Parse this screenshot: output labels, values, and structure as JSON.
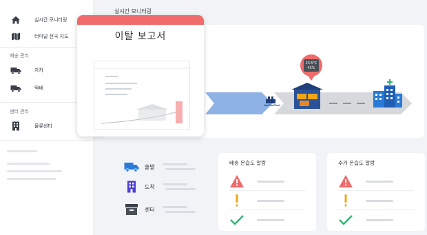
{
  "sidebar": {
    "items": [
      {
        "label": "실시간 모니터링",
        "icon": "home-icon"
      },
      {
        "label": "터미널 전국 지도",
        "icon": "map-icon"
      }
    ],
    "sections": [
      {
        "label": "배송 관리",
        "items": [
          {
            "label": "자차",
            "icon": "truck-icon"
          },
          {
            "label": "택배",
            "icon": "truck-icon"
          }
        ]
      },
      {
        "label": "센터 관리",
        "items": [
          {
            "label": "물류센터",
            "icon": "building-icon"
          }
        ]
      }
    ]
  },
  "main": {
    "title": "실시간 모니터링",
    "sensor_display": {
      "temp": "23.5°C",
      "humidity": "45%"
    }
  },
  "report": {
    "title": "이탈 보고서"
  },
  "legend": [
    {
      "label": "출발",
      "icon": "truck-icon"
    },
    {
      "label": "도착",
      "icon": "building-icon"
    },
    {
      "label": "센터",
      "icon": "box-icon"
    }
  ],
  "alarms": [
    {
      "title": "배송 온습도 알람"
    },
    {
      "title": "수거 온습도 알람"
    }
  ],
  "colors": {
    "accent": "#f06b6b",
    "blue": "#2a7bd8",
    "navy": "#1f3e7a",
    "flow_blue": "#8fb2e4",
    "flow_gray": "#d6d8dc",
    "warning": "#f2a516",
    "ok": "#2bb673"
  }
}
